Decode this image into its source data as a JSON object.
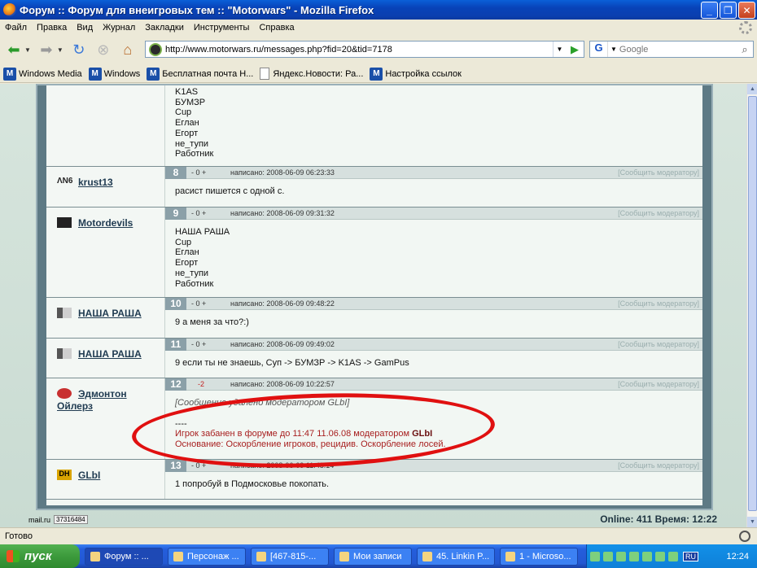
{
  "window": {
    "title": "Форум :: Форум для внеигровых тем :: \"Motorwars\" - Mozilla Firefox"
  },
  "menu": [
    "Файл",
    "Правка",
    "Вид",
    "Журнал",
    "Закладки",
    "Инструменты",
    "Справка"
  ],
  "nav": {
    "url": "http://www.motorwars.ru/messages.php?fid=20&tid=7178",
    "search_placeholder": "Google",
    "search_engine": "G"
  },
  "bookmarks": [
    "Windows Media",
    "Windows",
    "Бесплатная почта Н...",
    "Яндекс.Новости: Ра...",
    "Настройка ссылок"
  ],
  "posts": [
    {
      "number": "",
      "author": "",
      "body": [
        "K1AS",
        "БУМЗР",
        "Cup",
        "Еглан",
        "Егорт",
        "не_тупи",
        "Работник"
      ]
    },
    {
      "number": "8",
      "author": "krust13",
      "avatar_text": "ΛΝ6",
      "votes": "- 0 +",
      "date": "написано: 2008-06-09 06:23:33",
      "report": "[Сообщить модератору]",
      "body": [
        "расист пишется с одной с."
      ]
    },
    {
      "number": "9",
      "author": "Motordevils",
      "votes": "- 0 +",
      "date": "написано: 2008-06-09 09:31:32",
      "report": "[Сообщить модератору]",
      "body": [
        "НАША РАША",
        "Cup",
        "Еглан",
        "Егорт",
        "не_тупи",
        "Работник"
      ]
    },
    {
      "number": "10",
      "author": "НАША РАША",
      "votes": "- 0 +",
      "date": "написано: 2008-06-09 09:48:22",
      "report": "[Сообщить модератору]",
      "body": [
        "9 а меня за что?:)"
      ]
    },
    {
      "number": "11",
      "author": "НАША РАША",
      "votes": "- 0 +",
      "date": "написано: 2008-06-09 09:49:02",
      "report": "[Сообщить модератору]",
      "body": [
        "9 если ты не знаешь, Суп -> БУМЗР -> K1AS -> GamPus"
      ]
    },
    {
      "number": "12",
      "author_line1": "Эдмонтон",
      "author_line2": "Ойлерз",
      "votes": "-2",
      "date": "написано: 2008-06-09 10:22:57",
      "report": "[Сообщить модератору]",
      "note": "[Сообщение удалено модератором GLbI]",
      "separator": "----",
      "ban_line1_prefix": "Игрок забанен в форуме до 11:47 11.06.08 модератором ",
      "ban_moderator": "GLbI",
      "ban_line2": "Основание: Оскорбление игроков, рецидив. Оскорбление лосей."
    },
    {
      "number": "13",
      "author": "GLbI",
      "avatar_text": "DH",
      "votes": "- 0 +",
      "date": "написано: 2008-06-09 11:48:14",
      "report": "[Сообщить модератору]",
      "body": [
        "1 попробуй в Подмосковье покопать."
      ]
    }
  ],
  "footer": {
    "counter_label": "mail.ru",
    "counter_value": "37316484",
    "online": "Online: 411  Время: 12:22"
  },
  "status": "Готово",
  "taskbar": {
    "start": "пуск",
    "tasks": [
      "Форум :: ...",
      "Персонаж ...",
      "[467-815-...",
      "Мои записи",
      "45. Linkin P...",
      "1 - Microso..."
    ],
    "lang": "RU",
    "clock": "12:24"
  }
}
